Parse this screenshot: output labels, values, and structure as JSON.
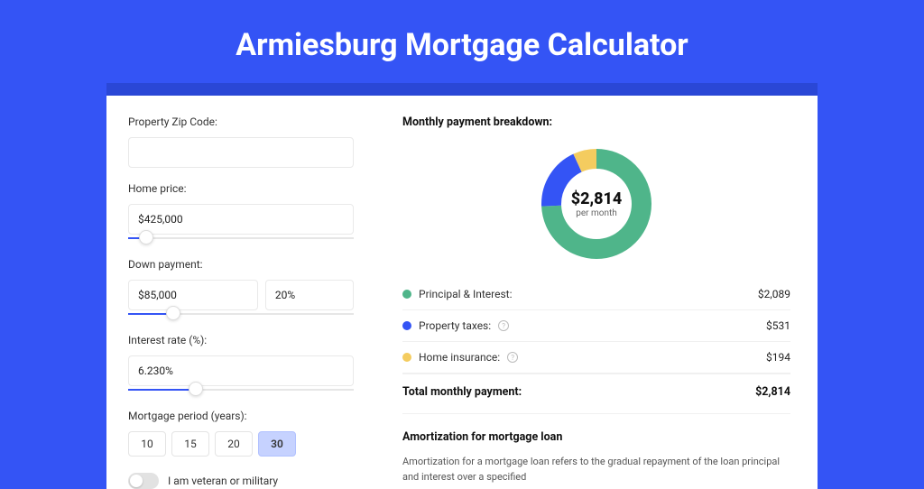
{
  "title": "Armiesburg Mortgage Calculator",
  "form": {
    "zip_label": "Property Zip Code:",
    "zip_value": "",
    "price_label": "Home price:",
    "price_value": "$425,000",
    "price_slider_pct": 8,
    "down_label": "Down payment:",
    "down_value": "$85,000",
    "down_pct_value": "20%",
    "down_slider_pct": 20,
    "rate_label": "Interest rate (%):",
    "rate_value": "6.230%",
    "rate_slider_pct": 30,
    "period_label": "Mortgage period (years):",
    "periods": [
      "10",
      "15",
      "20",
      "30"
    ],
    "period_selected": "30",
    "veteran_label": "I am veteran or military"
  },
  "breakdown": {
    "title": "Monthly payment breakdown:",
    "center_amount": "$2,814",
    "center_sub": "per month",
    "items": [
      {
        "label": "Principal & Interest:",
        "value": "$2,089",
        "color": "#4fb58a"
      },
      {
        "label": "Property taxes:",
        "value": "$531",
        "color": "#3454f5",
        "info": true
      },
      {
        "label": "Home insurance:",
        "value": "$194",
        "color": "#f4cc5f",
        "info": true
      }
    ],
    "total_label": "Total monthly payment:",
    "total_value": "$2,814"
  },
  "amort": {
    "title": "Amortization for mortgage loan",
    "text": "Amortization for a mortgage loan refers to the gradual repayment of the loan principal and interest over a specified"
  },
  "chart_data": {
    "type": "pie",
    "title": "Monthly payment breakdown",
    "series": [
      {
        "name": "Principal & Interest",
        "value": 2089,
        "color": "#4fb58a"
      },
      {
        "name": "Property taxes",
        "value": 531,
        "color": "#3454f5"
      },
      {
        "name": "Home insurance",
        "value": 194,
        "color": "#f4cc5f"
      }
    ],
    "total": 2814,
    "center_label": "$2,814 per month"
  }
}
